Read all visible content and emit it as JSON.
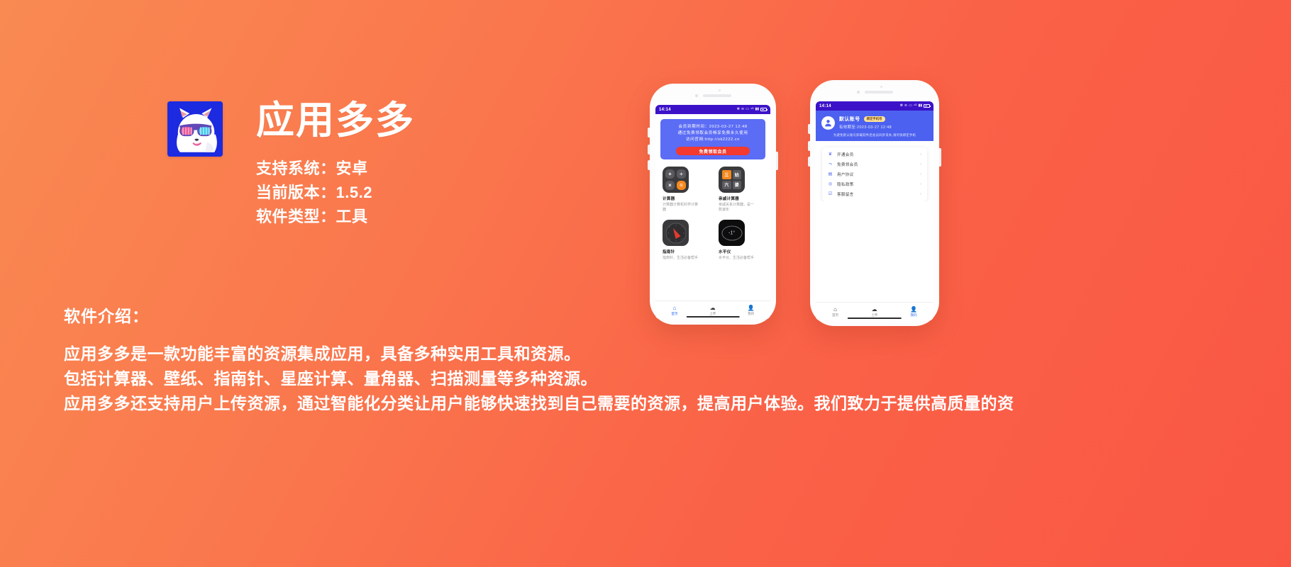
{
  "app": {
    "name": "应用多多",
    "icon_name": "cat-sunglasses-icon",
    "meta": [
      "支持系统：安卓",
      "当前版本：1.5.2",
      "软件类型：工具"
    ]
  },
  "intro": {
    "title": "软件介绍：",
    "lines": [
      "应用多多是一款功能丰富的资源集成应用，具备多种实用工具和资源。",
      "包括计算器、壁纸、指南针、星座计算、量角器、扫描测量等多种资源。",
      "应用多多还支持用户上传资源，通过智能化分类让用户能够快速找到自己需要的资源，提高用户体验。我们致力于提供高质量的资"
    ]
  },
  "phone_left": {
    "status": {
      "time": "14:14",
      "icons": [
        "bluetooth",
        "wifi",
        "signal",
        "4g",
        "network"
      ],
      "battery": "battery-icon"
    },
    "promo": {
      "lines": [
        "会员到期时间：2023-03-27 12:48",
        "通过免费领取会员畅享免费永久使用",
        "访问官网:http://xk2222.cn"
      ],
      "button": "免费领取会员"
    },
    "apps": [
      {
        "name": "计算器",
        "desc": "计算器计算机科学计算器",
        "icon": "calculator-icon"
      },
      {
        "name": "亲戚计算器",
        "desc": "亲戚关系计算器，是一款速年",
        "icon": "relatives-calculator-icon"
      },
      {
        "name": "指南针",
        "desc": "指南针、生活必备帮手",
        "icon": "compass-icon"
      },
      {
        "name": "水平仪",
        "desc": "水平仪、生活必备帮手",
        "icon": "level-icon",
        "reading": "-1°"
      }
    ],
    "tabs": [
      {
        "label": "首页",
        "icon": "home-icon",
        "active": true
      },
      {
        "label": "上传",
        "icon": "upload-cloud-icon",
        "active": false
      },
      {
        "label": "我的",
        "icon": "person-icon",
        "active": false
      }
    ]
  },
  "phone_right": {
    "status": {
      "time": "14:14",
      "battery": "battery-icon"
    },
    "profile": {
      "avatar": "avatar-icon",
      "name": "默认账号",
      "badge": "绑定手机号",
      "expiry": "有效期至:2023-03-27 12:48",
      "note": "为避免默认账号卸载软件后会员同步丢失,请尽快绑定手机"
    },
    "menu": [
      {
        "label": "开通会员",
        "icon": "vip-crown-icon",
        "arrow": "›"
      },
      {
        "label": "免费领会员",
        "icon": "share-icon",
        "arrow": "›"
      },
      {
        "label": "用户协议",
        "icon": "document-icon",
        "arrow": "›"
      },
      {
        "label": "隐私政策",
        "icon": "shield-lock-icon",
        "arrow": "›"
      },
      {
        "label": "客服留言",
        "icon": "message-edit-icon",
        "arrow": "›"
      }
    ],
    "tabs": [
      {
        "label": "首页",
        "icon": "home-icon",
        "active": false
      },
      {
        "label": "上传",
        "icon": "upload-cloud-icon",
        "active": false
      },
      {
        "label": "我的",
        "icon": "person-icon",
        "active": true
      }
    ]
  },
  "colors": {
    "bg_start": "#f98a52",
    "bg_end": "#f95744",
    "icon_bg": "#1c2ae0",
    "promo_bg": "#5b6cf5",
    "promo_btn": "#f4392f",
    "statusbar": "#3c12c8",
    "profile_hdr": "#4c61ef",
    "accent_blue": "#2f6cf6",
    "badge_bg": "#fde39a"
  }
}
